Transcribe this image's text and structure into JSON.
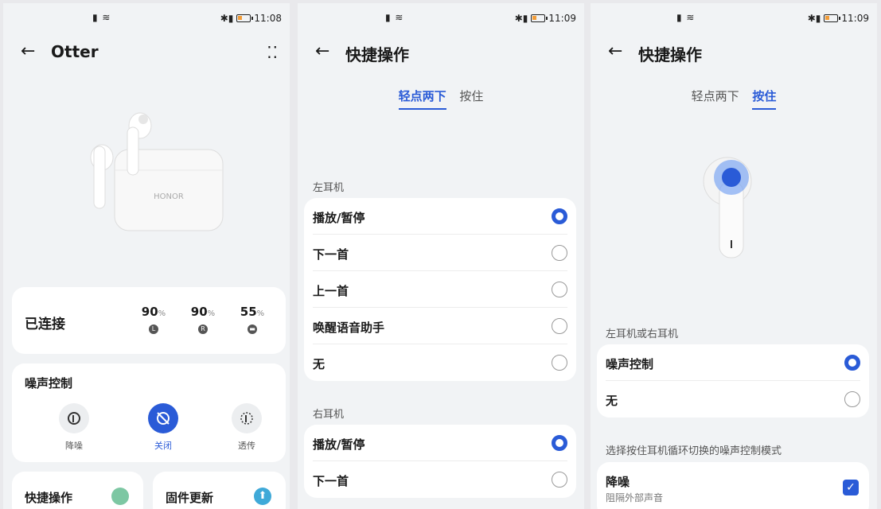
{
  "screen1": {
    "status": {
      "time": "11:08"
    },
    "title": "Otter",
    "brand": "HONOR",
    "connected": "已连接",
    "battery": [
      {
        "pct": "90",
        "unit": "%",
        "side": "L"
      },
      {
        "pct": "90",
        "unit": "%",
        "side": "R"
      },
      {
        "pct": "55",
        "unit": "%",
        "side": ""
      }
    ],
    "noise": {
      "title": "噪声控制",
      "modes": [
        "降噪",
        "关闭",
        "透传"
      ],
      "active": "关闭"
    },
    "quick_label": "快捷操作",
    "firmware_label": "固件更新"
  },
  "screen2": {
    "status": {
      "time": "11:09"
    },
    "title": "快捷操作",
    "tabs": [
      "轻点两下",
      "按住"
    ],
    "active_tab": "轻点两下",
    "left_section": "左耳机",
    "left_options": [
      "播放/暂停",
      "下一首",
      "上一首",
      "唤醒语音助手",
      "无"
    ],
    "right_section": "右耳机",
    "right_options": [
      "播放/暂停",
      "下一首"
    ]
  },
  "screen3": {
    "status": {
      "time": "11:09"
    },
    "title": "快捷操作",
    "tabs": [
      "轻点两下",
      "按住"
    ],
    "active_tab": "按住",
    "section1": "左耳机或右耳机",
    "options": [
      "噪声控制",
      "无"
    ],
    "section2": "选择按住耳机循环切换的噪声控制模式",
    "mode_item": {
      "label": "降噪",
      "desc": "阻隔外部声音"
    }
  },
  "colors": {
    "accent": "#2a5bd7"
  }
}
